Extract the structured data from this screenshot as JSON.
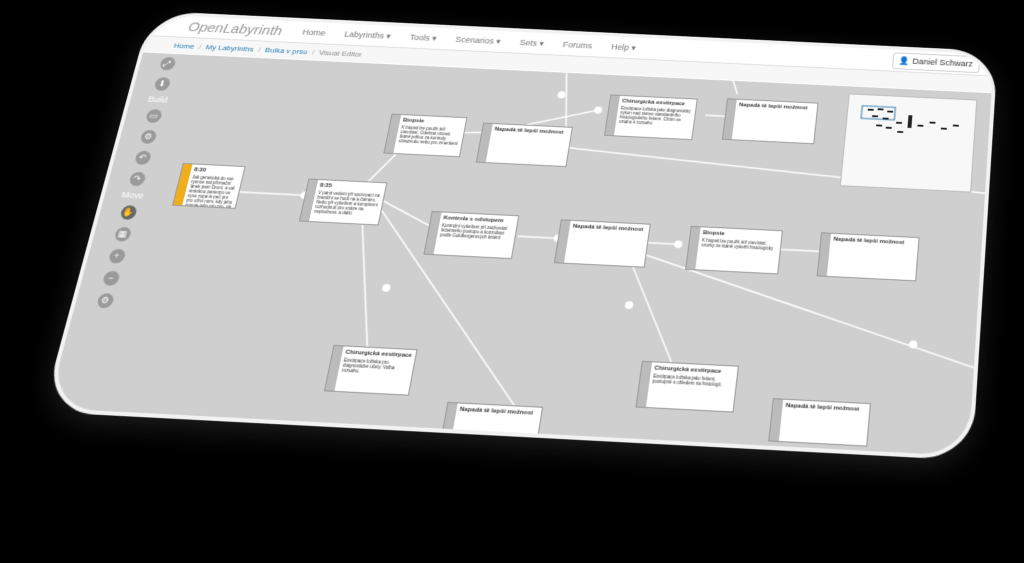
{
  "topbar": {
    "brand": "OpenLabyrinth",
    "nav": [
      "Home",
      "Labyrinths ▾",
      "Tools ▾",
      "Scenarios ▾",
      "Sets ▾",
      "Forums",
      "Help ▾"
    ],
    "user": "Daniel Schwarz"
  },
  "breadcrumb": {
    "home": "Home",
    "labyrinths": "My Labyrinths",
    "map": "Bulka v prsu",
    "current": "Visual Editor"
  },
  "toolbar": {
    "build_label": "Build",
    "move_label": "Move"
  },
  "nodes": [
    {
      "title": "8:30",
      "text": "Jak genetická do vat-ryonce nal příznační 'ánek pani Oroní, a val stránkou panenpo ve vyso zopa le peč pro pro oživí nom, kdy jeho novoje jeho pro pro, dá za stanovem plné"
    },
    {
      "title": "8:35",
      "text": "V pánit vedení při sporovací na hraniční se hodí na a čtěném. Nebo při vyšetření a komplexní rozhodnutí pro snáze na neplodnost, a další"
    },
    {
      "title": "Biopsie",
      "text": "K biopsii lze použít též otevírání. Odebrat vzorek tkáně jehlou za kontroly ultrazvuku nebo pro zmenšení"
    },
    {
      "title": "Napadá tě lepší možnost",
      "text": ""
    },
    {
      "title": "Chirurgická exstirpace",
      "text": "Exstirpace ložiska jako diagnostický výkon nad rámec standardního histologického řešení. Ctítím ve vztahu k rozsahu"
    },
    {
      "title": "Napadá tě lepší možnost",
      "text": ""
    },
    {
      "title": "Kontrola s odstupem",
      "text": "Kontrolní vyšetření při zachování léčebného postupu a konzultaci podle Goldbergerových kritérií"
    },
    {
      "title": "Napadá tě lepší možnost",
      "text": ""
    },
    {
      "title": "Biopsie",
      "text": "K biopsii lze použít též otevírání, vzorky ze tkáně vyšetřit histologicky"
    },
    {
      "title": "Napadá tě lepší možnost",
      "text": ""
    },
    {
      "title": "Chirurgická exstirpace",
      "text": "Exstirpace ložiska pro diagnostické účely. Volba rozsahu."
    },
    {
      "title": "Chirurgická exstirpace",
      "text": "Exstirpace ložiska jako řešení, postupně s ohledem na histologii."
    },
    {
      "title": "Napadá tě lepší možnost",
      "text": ""
    },
    {
      "title": "Napadá tě lepší možnost",
      "text": ""
    }
  ],
  "colors": {
    "accent": "#f0ad1e",
    "canvas": "#cfcfcf",
    "link": "#2a7ab0"
  }
}
